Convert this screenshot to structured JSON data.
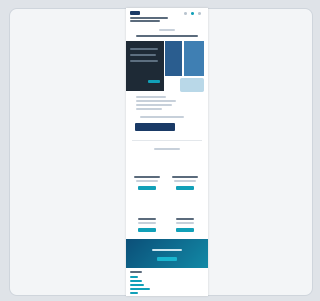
{
  "colors": {
    "page_bg": "#ffffff",
    "brand_navy": "#1a3a66",
    "accent_teal": "#11a0b8",
    "dark_panel": "#1e2a36",
    "text_placeholder": "#c7d0da"
  },
  "sections": [
    "header",
    "hero",
    "product-images",
    "intro-text",
    "primary-button",
    "divider",
    "section-heading",
    "feature-grid-row-1",
    "feature-grid-row-2",
    "cta-banner",
    "footer"
  ],
  "icons": [
    "logo-icon",
    "search-icon",
    "account-icon",
    "menu-icon"
  ]
}
